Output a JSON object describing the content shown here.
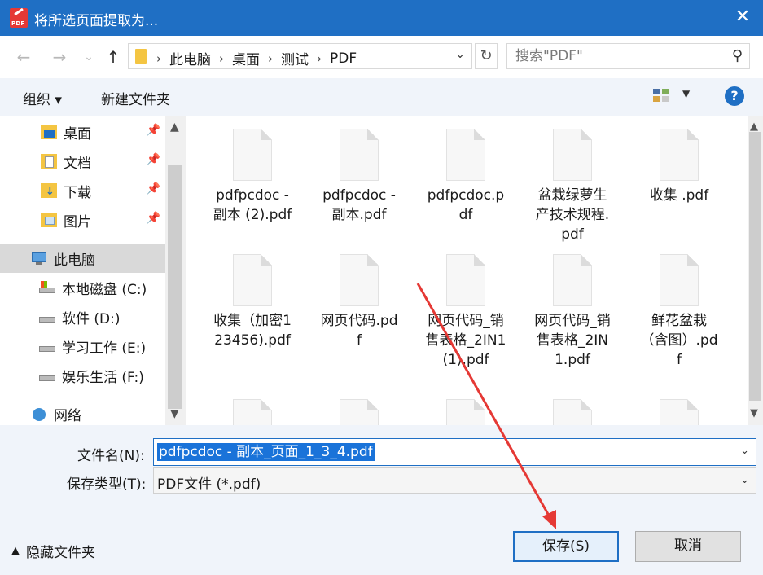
{
  "window": {
    "title": "将所选页面提取为...",
    "app_icon": "pdf-app-icon",
    "app_icon_label": "PDF",
    "close_label": "✕"
  },
  "nav": {
    "back": "←",
    "forward": "→",
    "recent": "⌄",
    "up": "↑",
    "breadcrumbs": [
      "此电脑",
      "桌面",
      "测试",
      "PDF"
    ],
    "refresh": "↻",
    "search_placeholder": "搜索\"PDF\""
  },
  "toolbar": {
    "organize": "组织 ▾",
    "new_folder": "新建文件夹",
    "help": "?"
  },
  "sidebar": {
    "items": [
      {
        "label": "桌面",
        "icon": "desktop-folder-icon",
        "pinned": true
      },
      {
        "label": "文档",
        "icon": "documents-folder-icon",
        "pinned": true
      },
      {
        "label": "下载",
        "icon": "downloads-folder-icon",
        "pinned": true
      },
      {
        "label": "图片",
        "icon": "pictures-folder-icon",
        "pinned": true
      },
      {
        "label": "此电脑",
        "icon": "computer-icon",
        "pinned": false,
        "selected": true
      },
      {
        "label": "本地磁盘 (C:)",
        "icon": "drive-icon"
      },
      {
        "label": "软件 (D:)",
        "icon": "drive-icon"
      },
      {
        "label": "学习工作 (E:)",
        "icon": "drive-icon"
      },
      {
        "label": "娱乐生活 (F:)",
        "icon": "drive-icon"
      },
      {
        "label": "网络",
        "icon": "network-icon"
      }
    ]
  },
  "files": [
    {
      "name": "pdfpcdoc - 副本 (2).pdf"
    },
    {
      "name": "pdfpcdoc - 副本.pdf"
    },
    {
      "name": "pdfpcdoc.pdf"
    },
    {
      "name": "盆栽绿萝生产技术规程.pdf"
    },
    {
      "name": "收集 .pdf"
    },
    {
      "name": "收集（加密123456).pdf"
    },
    {
      "name": "网页代码.pdf"
    },
    {
      "name": "网页代码_销售表格_2IN1(1).pdf"
    },
    {
      "name": "网页代码_销售表格_2IN1.pdf"
    },
    {
      "name": "鲜花盆栽（含图）.pdf"
    }
  ],
  "form": {
    "filename_label": "文件名(N):",
    "filename_value": "pdfpcdoc - 副本_页面_1_3_4.pdf",
    "filetype_label": "保存类型(T):",
    "filetype_value": "PDF文件 (*.pdf)",
    "hide_folders": "隐藏文件夹",
    "save": "保存(S)",
    "cancel": "取消"
  },
  "colors": {
    "title_bar": "#1f6fc4",
    "annotation_arrow": "#e53935"
  }
}
